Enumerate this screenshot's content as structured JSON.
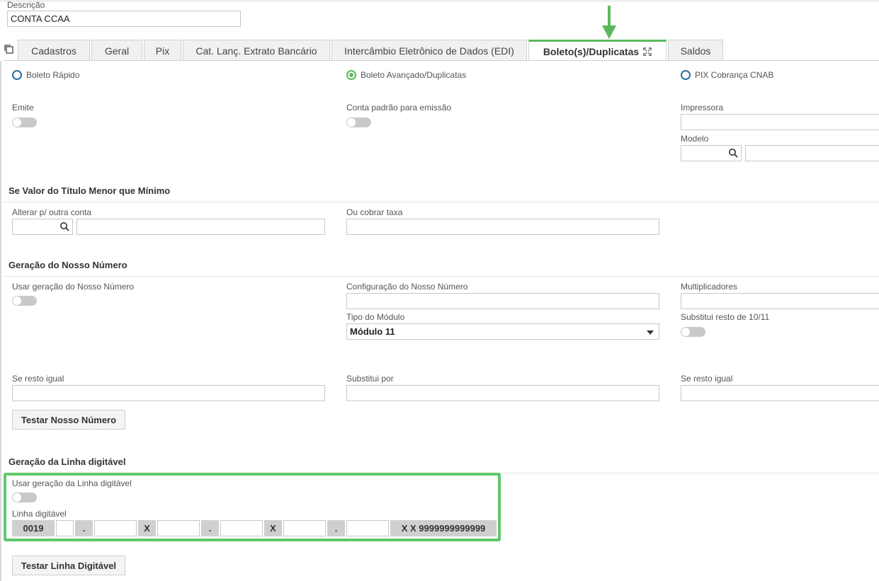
{
  "descricao": {
    "label": "Descrição",
    "value": "CONTA CCAA"
  },
  "tabs": [
    {
      "label": "Cadastros"
    },
    {
      "label": "Geral"
    },
    {
      "label": "Pix"
    },
    {
      "label": "Cat. Lanç. Extrato Bancário"
    },
    {
      "label": "Intercâmbio Eletrônico de Dados (EDI)"
    },
    {
      "label": "Boleto(s)/Duplicatas"
    },
    {
      "label": "Saldos"
    }
  ],
  "radios": {
    "rapido": "Boleto Rápido",
    "avancado": "Boleto Avançado/Duplicatas",
    "pix": "PIX Cobrança CNAB"
  },
  "emissao": {
    "emite": "Emite",
    "conta_padrao": "Conta padrão para emissão",
    "impressora": "Impressora",
    "modelo": "Modelo"
  },
  "minimo": {
    "title": "Se Valor do Título Menor que Mínimo",
    "alterar": "Alterar p/ outra conta",
    "cobrar": "Ou cobrar taxa"
  },
  "nosso_numero": {
    "title": "Geração do Nosso Número",
    "usar": "Usar geração do Nosso Número",
    "configuracao": "Configuração do Nosso Número",
    "multiplicadores": "Multiplicadores",
    "tipo_modulo": "Tipo do Módulo",
    "tipo_modulo_value": "Módulo 11",
    "substitui_resto": "Substitui resto de 10/11",
    "se_resto_1": "Se resto igual",
    "substitui_por": "Substitui por",
    "se_resto_2": "Se resto igual",
    "testar": "Testar Nosso Número"
  },
  "linha": {
    "title": "Geração da Linha digitável",
    "usar": "Usar geração da Linha digitável",
    "label": "Linha digitável",
    "seg_bank": "0019",
    "dot": ".",
    "x": "X",
    "final": "X X 9999999999999",
    "testar": "Testar Linha Digitável"
  },
  "colors": {
    "accent": "#5cb85c",
    "radio": "#2b6f9e"
  }
}
